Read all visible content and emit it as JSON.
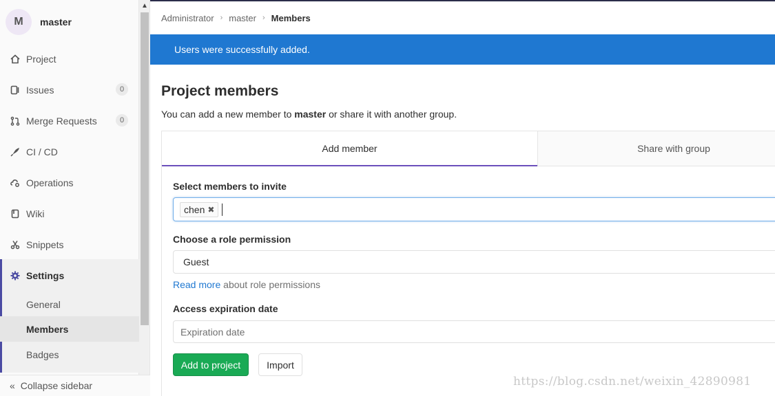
{
  "project": {
    "avatar_letter": "M",
    "name": "master"
  },
  "sidebar": {
    "items": [
      {
        "label": "Project",
        "icon": "home-icon"
      },
      {
        "label": "Issues",
        "icon": "issues-icon",
        "count": "0"
      },
      {
        "label": "Merge Requests",
        "icon": "merge-request-icon",
        "count": "0"
      },
      {
        "label": "CI / CD",
        "icon": "rocket-icon"
      },
      {
        "label": "Operations",
        "icon": "cloud-gear-icon"
      },
      {
        "label": "Wiki",
        "icon": "book-icon"
      },
      {
        "label": "Snippets",
        "icon": "scissors-icon"
      },
      {
        "label": "Settings",
        "icon": "gear-icon"
      }
    ],
    "settings_sub": [
      "General",
      "Members",
      "Badges"
    ],
    "collapse_label": "Collapse sidebar"
  },
  "breadcrumbs": [
    "Administrator",
    "master",
    "Members"
  ],
  "flash": "Users were successfully added.",
  "page": {
    "title": "Project members",
    "desc_pre": "You can add a new member to ",
    "desc_bold": "master",
    "desc_post": " or share it with another group."
  },
  "tabs": [
    "Add member",
    "Share with group"
  ],
  "form": {
    "invite_label": "Select members to invite",
    "token": "chen",
    "role_label": "Choose a role permission",
    "role_value": "Guest",
    "help_link": "Read more",
    "help_text": " about role permissions",
    "expiration_label": "Access expiration date",
    "expiration_placeholder": "Expiration date",
    "add_button": "Add to project",
    "import_button": "Import"
  },
  "watermark": "https://blog.csdn.net/weixin_42890981",
  "colors": {
    "flash": "#1f78d1",
    "add_button": "#1aaa55",
    "active_tab": "#6b4fbb",
    "active_bar": "#4b4ba3"
  }
}
